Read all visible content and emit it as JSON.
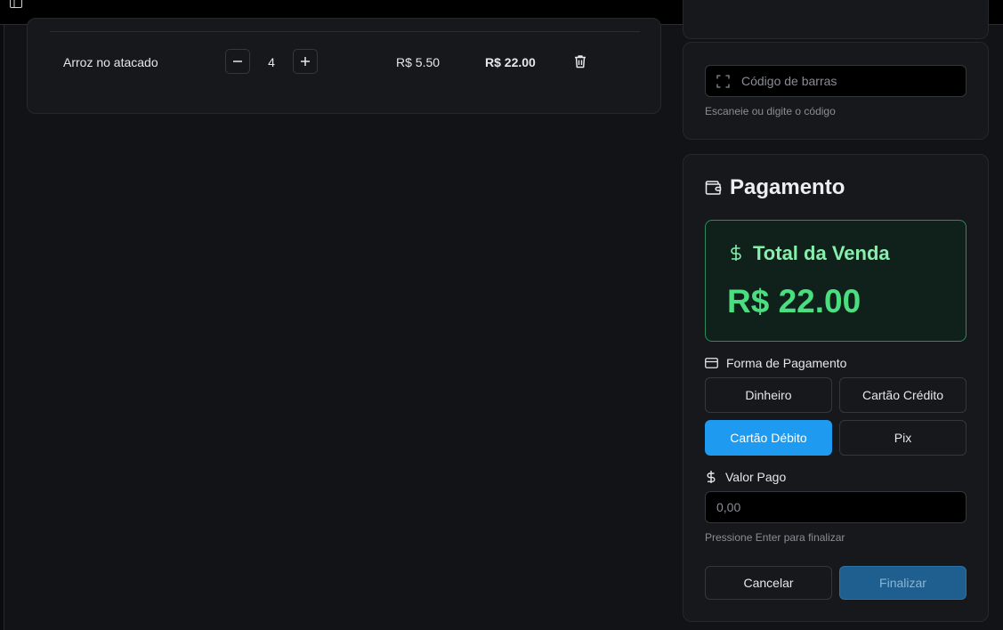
{
  "cart": {
    "items": [
      {
        "name": "Arroz no atacado",
        "quantity": "4",
        "unit_price": "R$ 5.50",
        "total": "R$ 22.00"
      }
    ]
  },
  "barcode": {
    "placeholder": "Código de barras",
    "hint": "Escaneie ou digite o código"
  },
  "payment": {
    "title": "Pagamento",
    "total_label": "Total da Venda",
    "total_value": "R$ 22.00",
    "method_label": "Forma de Pagamento",
    "methods": [
      "Dinheiro",
      "Cartão Crédito",
      "Cartão Débito",
      "Pix"
    ],
    "selected_method": "Cartão Débito",
    "paid_label": "Valor Pago",
    "paid_placeholder": "0,00",
    "paid_hint": "Pressione Enter para finalizar",
    "cancel_label": "Cancelar",
    "finalize_label": "Finalizar"
  },
  "colors": {
    "accent": "#1e9bf0",
    "total_green": "#4ade80",
    "background": "#121317",
    "card": "#17181c"
  },
  "icons": [
    "sidebar-toggle-icon",
    "minus-icon",
    "plus-icon",
    "trash-icon",
    "scan-icon",
    "wallet-icon",
    "dollar-icon",
    "credit-card-icon"
  ]
}
